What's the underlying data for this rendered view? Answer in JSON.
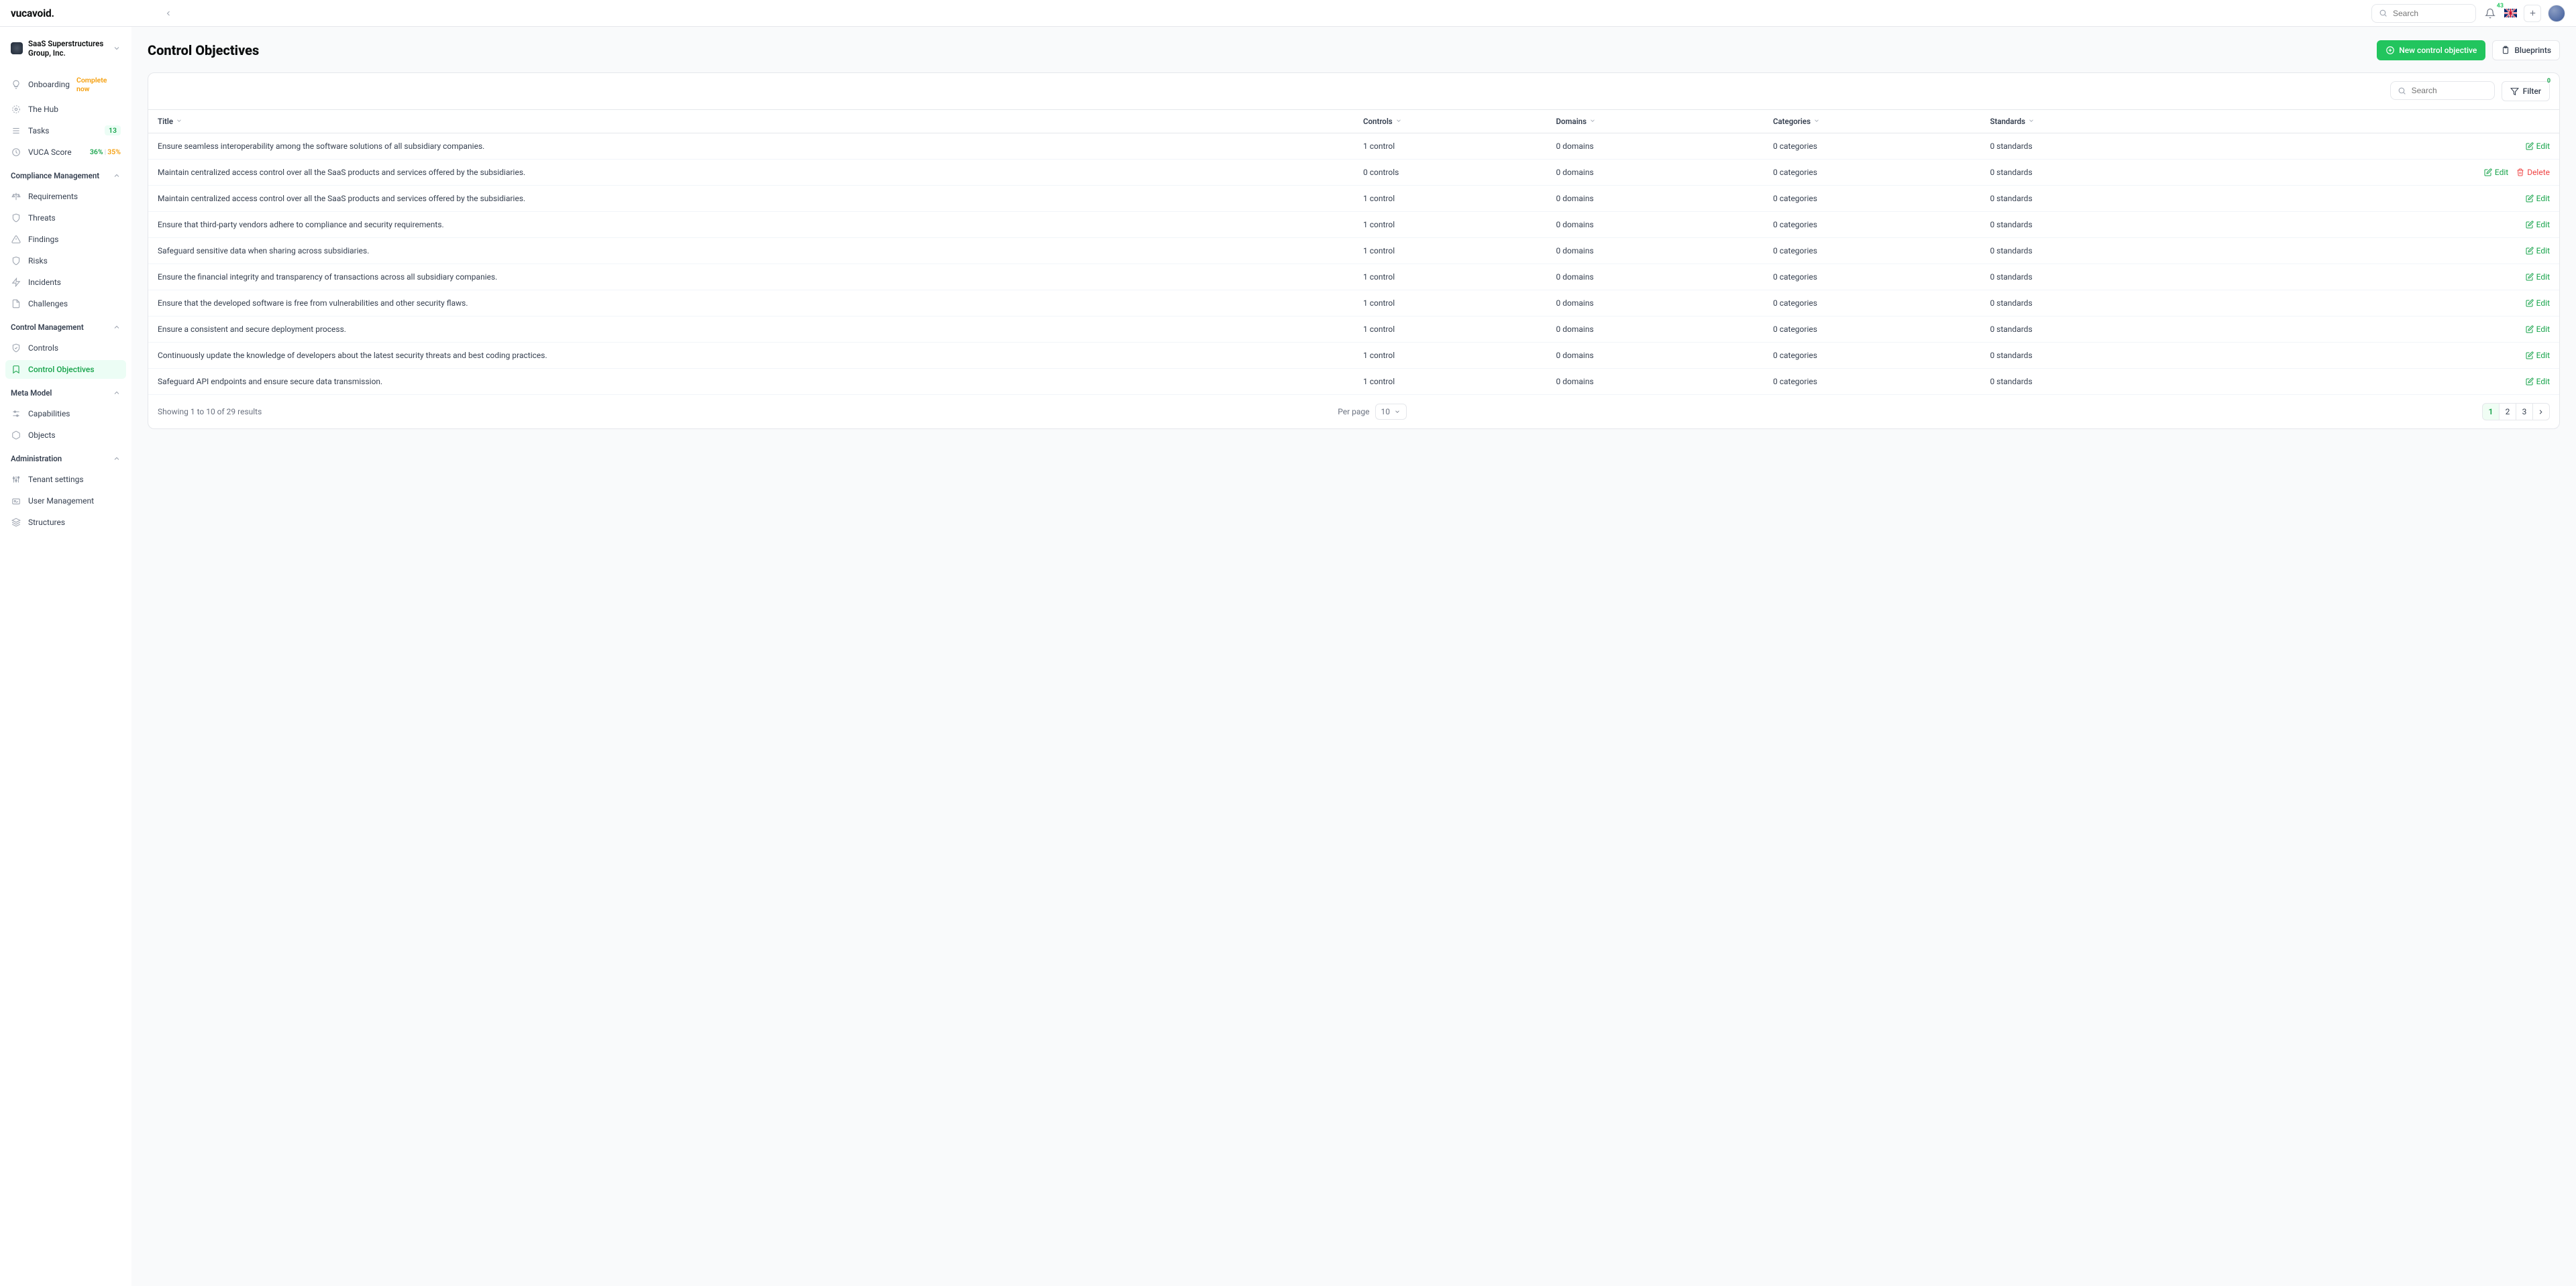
{
  "brand": "vucavoid.",
  "top": {
    "search_placeholder": "Search",
    "notification_count": "43"
  },
  "org": {
    "name": "SaaS Superstructures Group, Inc."
  },
  "nav": {
    "onboarding": {
      "label": "Onboarding",
      "tag": "Complete now"
    },
    "hub": "The Hub",
    "tasks": {
      "label": "Tasks",
      "count": "13"
    },
    "vuca": {
      "label": "VUCA Score",
      "v1": "36%",
      "sep": "|",
      "v2": "35%"
    },
    "groups": {
      "compliance": {
        "label": "Compliance Management",
        "items": {
          "requirements": "Requirements",
          "threats": "Threats",
          "findings": "Findings",
          "risks": "Risks",
          "incidents": "Incidents",
          "challenges": "Challenges"
        }
      },
      "control": {
        "label": "Control Management",
        "items": {
          "controls": "Controls",
          "objectives": "Control Objectives"
        }
      },
      "meta": {
        "label": "Meta Model",
        "items": {
          "capabilities": "Capabilities",
          "objects": "Objects"
        }
      },
      "admin": {
        "label": "Administration",
        "items": {
          "tenant": "Tenant settings",
          "users": "User Management",
          "structures": "Structures"
        }
      }
    }
  },
  "page": {
    "title": "Control Objectives",
    "new_btn": "New control objective",
    "blueprints_btn": "Blueprints",
    "search_placeholder": "Search",
    "filter_label": "Filter",
    "filter_count": "0"
  },
  "chart_data": {
    "type": "table",
    "columns": {
      "title": "Title",
      "controls": "Controls",
      "domains": "Domains",
      "categories": "Categories",
      "standards": "Standards"
    },
    "rows": [
      {
        "title": "Ensure seamless interoperability among the software solutions of all subsidiary companies.",
        "controls": "1 control",
        "domains": "0 domains",
        "categories": "0 categories",
        "standards": "0 standards",
        "del": false
      },
      {
        "title": "Maintain centralized access control over all the SaaS products and services offered by the subsidiaries.",
        "controls": "0 controls",
        "domains": "0 domains",
        "categories": "0 categories",
        "standards": "0 standards",
        "del": true
      },
      {
        "title": "Maintain centralized access control over all the SaaS products and services offered by the subsidiaries.",
        "controls": "1 control",
        "domains": "0 domains",
        "categories": "0 categories",
        "standards": "0 standards",
        "del": false
      },
      {
        "title": "Ensure that third-party vendors adhere to compliance and security requirements.",
        "controls": "1 control",
        "domains": "0 domains",
        "categories": "0 categories",
        "standards": "0 standards",
        "del": false
      },
      {
        "title": "Safeguard sensitive data when sharing across subsidiaries.",
        "controls": "1 control",
        "domains": "0 domains",
        "categories": "0 categories",
        "standards": "0 standards",
        "del": false
      },
      {
        "title": "Ensure the financial integrity and transparency of transactions across all subsidiary companies.",
        "controls": "1 control",
        "domains": "0 domains",
        "categories": "0 categories",
        "standards": "0 standards",
        "del": false
      },
      {
        "title": "Ensure that the developed software is free from vulnerabilities and other security flaws.",
        "controls": "1 control",
        "domains": "0 domains",
        "categories": "0 categories",
        "standards": "0 standards",
        "del": false
      },
      {
        "title": "Ensure a consistent and secure deployment process.",
        "controls": "1 control",
        "domains": "0 domains",
        "categories": "0 categories",
        "standards": "0 standards",
        "del": false
      },
      {
        "title": "Continuously update the knowledge of developers about the latest security threats and best coding practices.",
        "controls": "1 control",
        "domains": "0 domains",
        "categories": "0 categories",
        "standards": "0 standards",
        "del": false
      },
      {
        "title": "Safeguard API endpoints and ensure secure data transmission.",
        "controls": "1 control",
        "domains": "0 domains",
        "categories": "0 categories",
        "standards": "0 standards",
        "del": false
      }
    ]
  },
  "actions": {
    "edit": "Edit",
    "delete": "Delete"
  },
  "footer": {
    "summary": "Showing 1 to 10 of 29 results",
    "perpage_label": "Per page",
    "perpage_value": "10",
    "pages": [
      "1",
      "2",
      "3"
    ]
  }
}
